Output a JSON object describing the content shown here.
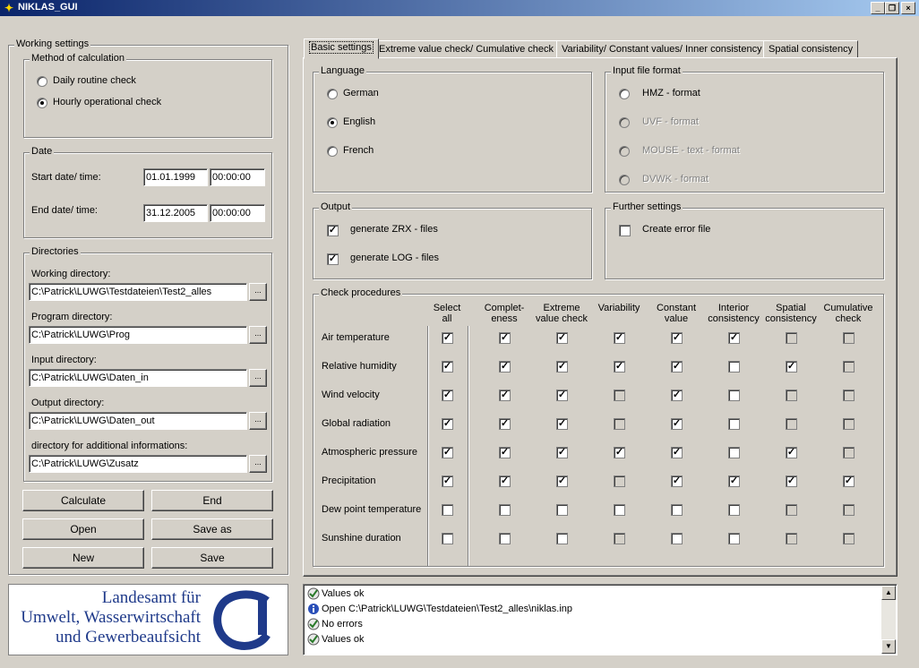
{
  "window": {
    "title": "NIKLAS_GUI",
    "min": "_",
    "restore": "❐",
    "close": "×"
  },
  "working": {
    "title": "Working settings",
    "method": {
      "title": "Method of calculation",
      "daily": "Daily routine check",
      "hourly": "Hourly operational check",
      "selected": "hourly"
    },
    "date": {
      "title": "Date",
      "start_label": "Start date/ time:",
      "start_date": "01.01.1999",
      "start_time": "00:00:00",
      "end_label": "End date/ time:",
      "end_date": "31.12.2005",
      "end_time": "00:00:00"
    },
    "dirs": {
      "title": "Directories",
      "browse": "...",
      "items": [
        {
          "label": "Working directory:",
          "value": "C:\\Patrick\\LUWG\\Testdateien\\Test2_alles"
        },
        {
          "label": "Program directory:",
          "value": "C:\\Patrick\\LUWG\\Prog"
        },
        {
          "label": "Input directory:",
          "value": "C:\\Patrick\\LUWG\\Daten_in"
        },
        {
          "label": "Output directory:",
          "value": "C:\\Patrick\\LUWG\\Daten_out"
        },
        {
          "label": "directory for additional informations:",
          "value": "C:\\Patrick\\LUWG\\Zusatz"
        }
      ]
    }
  },
  "buttons": {
    "calculate": "Calculate",
    "end": "End",
    "open": "Open",
    "save_as": "Save as",
    "new": "New",
    "save": "Save"
  },
  "logo": {
    "line1": "Landesamt für",
    "line2": "Umwelt, Wasserwirtschaft",
    "line3": "und Gewerbeaufsicht"
  },
  "tabs": [
    "Basic settings",
    "Extreme value check/ Cumulative check",
    "Variability/ Constant values/ Inner consistency",
    "Spatial consistency"
  ],
  "language": {
    "title": "Language",
    "options": [
      "German",
      "English",
      "French"
    ],
    "selected": "English"
  },
  "input_format": {
    "title": "Input file format",
    "options": [
      "HMZ - format",
      "UVF - format",
      "MOUSE - text - format",
      "DVWK - format"
    ]
  },
  "output": {
    "title": "Output",
    "zrx": "generate ZRX - files",
    "log": "generate LOG - files"
  },
  "further": {
    "title": "Further settings",
    "error_file": "Create error file"
  },
  "check": {
    "title": "Check procedures",
    "select_all_l1": "Select",
    "select_all_l2": "all",
    "columns": [
      {
        "l1": "Complet-",
        "l2": "eness"
      },
      {
        "l1": "Extreme",
        "l2": "value check"
      },
      {
        "l1": "Variability",
        "l2": ""
      },
      {
        "l1": "Constant",
        "l2": "value"
      },
      {
        "l1": "Interior",
        "l2": "consistency"
      },
      {
        "l1": "Spatial",
        "l2": "consistency"
      },
      {
        "l1": "Cumulative",
        "l2": "check"
      }
    ],
    "rows": [
      {
        "name": "Air temperature",
        "all": 1,
        "v": [
          1,
          1,
          1,
          1,
          1,
          0,
          0
        ],
        "dis": [
          0,
          0,
          0,
          0,
          0,
          1,
          1
        ]
      },
      {
        "name": "Relative humidity",
        "all": 1,
        "v": [
          1,
          1,
          1,
          1,
          0,
          1,
          0
        ],
        "dis": [
          0,
          0,
          0,
          0,
          0,
          0,
          1
        ]
      },
      {
        "name": "Wind velocity",
        "all": 1,
        "v": [
          1,
          1,
          0,
          1,
          0,
          0,
          0
        ],
        "dis": [
          0,
          0,
          1,
          0,
          0,
          1,
          1
        ]
      },
      {
        "name": "Global radiation",
        "all": 1,
        "v": [
          1,
          1,
          0,
          1,
          0,
          0,
          0
        ],
        "dis": [
          0,
          0,
          1,
          0,
          0,
          1,
          1
        ]
      },
      {
        "name": "Atmospheric pressure",
        "all": 1,
        "v": [
          1,
          1,
          1,
          1,
          0,
          1,
          0
        ],
        "dis": [
          0,
          0,
          0,
          0,
          0,
          0,
          1
        ]
      },
      {
        "name": "Precipitation",
        "all": 1,
        "v": [
          1,
          1,
          0,
          1,
          1,
          1,
          1
        ],
        "dis": [
          0,
          0,
          1,
          0,
          0,
          0,
          0
        ]
      },
      {
        "name": "Dew point temperature",
        "all": 0,
        "v": [
          0,
          0,
          0,
          0,
          0,
          0,
          0
        ],
        "dis": [
          0,
          0,
          0,
          0,
          0,
          1,
          1
        ]
      },
      {
        "name": "Sunshine duration",
        "all": 0,
        "v": [
          0,
          0,
          0,
          0,
          0,
          0,
          0
        ],
        "dis": [
          0,
          0,
          1,
          0,
          0,
          1,
          1
        ]
      }
    ]
  },
  "log": [
    {
      "icon": "ok-icon",
      "text": "Values ok"
    },
    {
      "icon": "info-icon",
      "text": "Open C:\\Patrick\\LUWG\\Testdateien\\Test2_alles\\niklas.inp"
    },
    {
      "icon": "ok-icon",
      "text": "No errors"
    },
    {
      "icon": "ok-icon",
      "text": "Values ok"
    }
  ]
}
